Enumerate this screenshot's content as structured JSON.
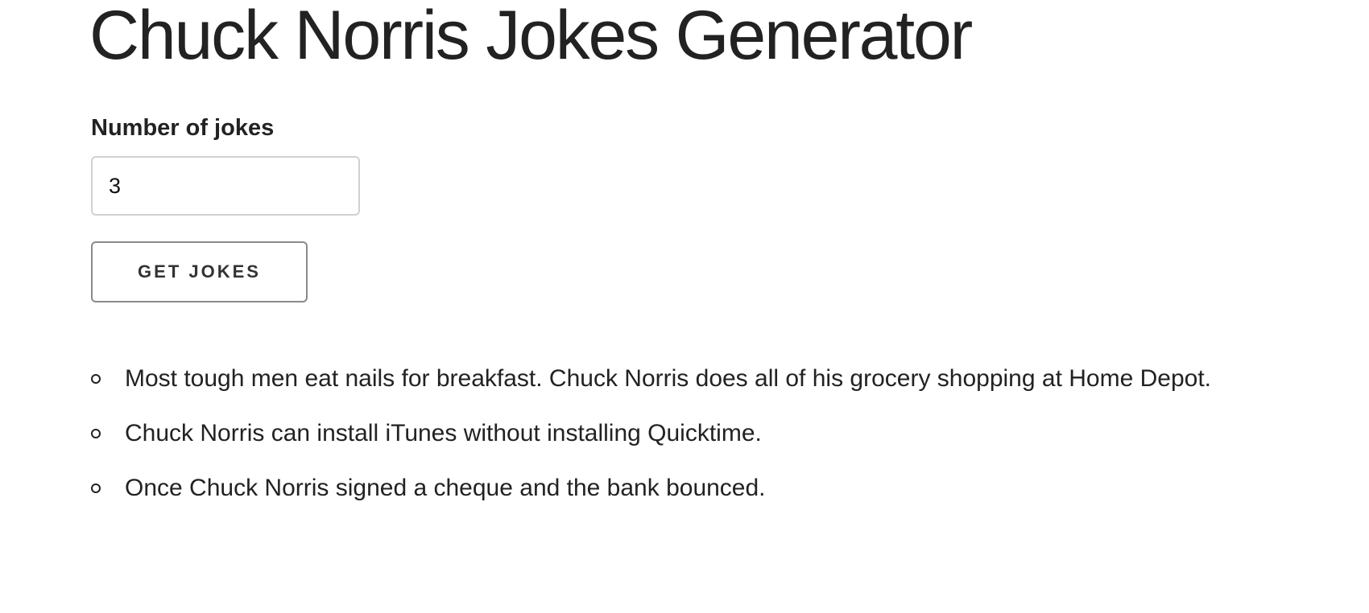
{
  "page": {
    "title": "Chuck Norris Jokes Generator"
  },
  "form": {
    "label": "Number of jokes",
    "input_value": "3",
    "button_label": "GET JOKES"
  },
  "jokes": [
    "Most tough men eat nails for breakfast. Chuck Norris does all of his grocery shopping at Home Depot.",
    "Chuck Norris can install iTunes without installing Quicktime.",
    "Once Chuck Norris signed a cheque and the bank bounced."
  ]
}
